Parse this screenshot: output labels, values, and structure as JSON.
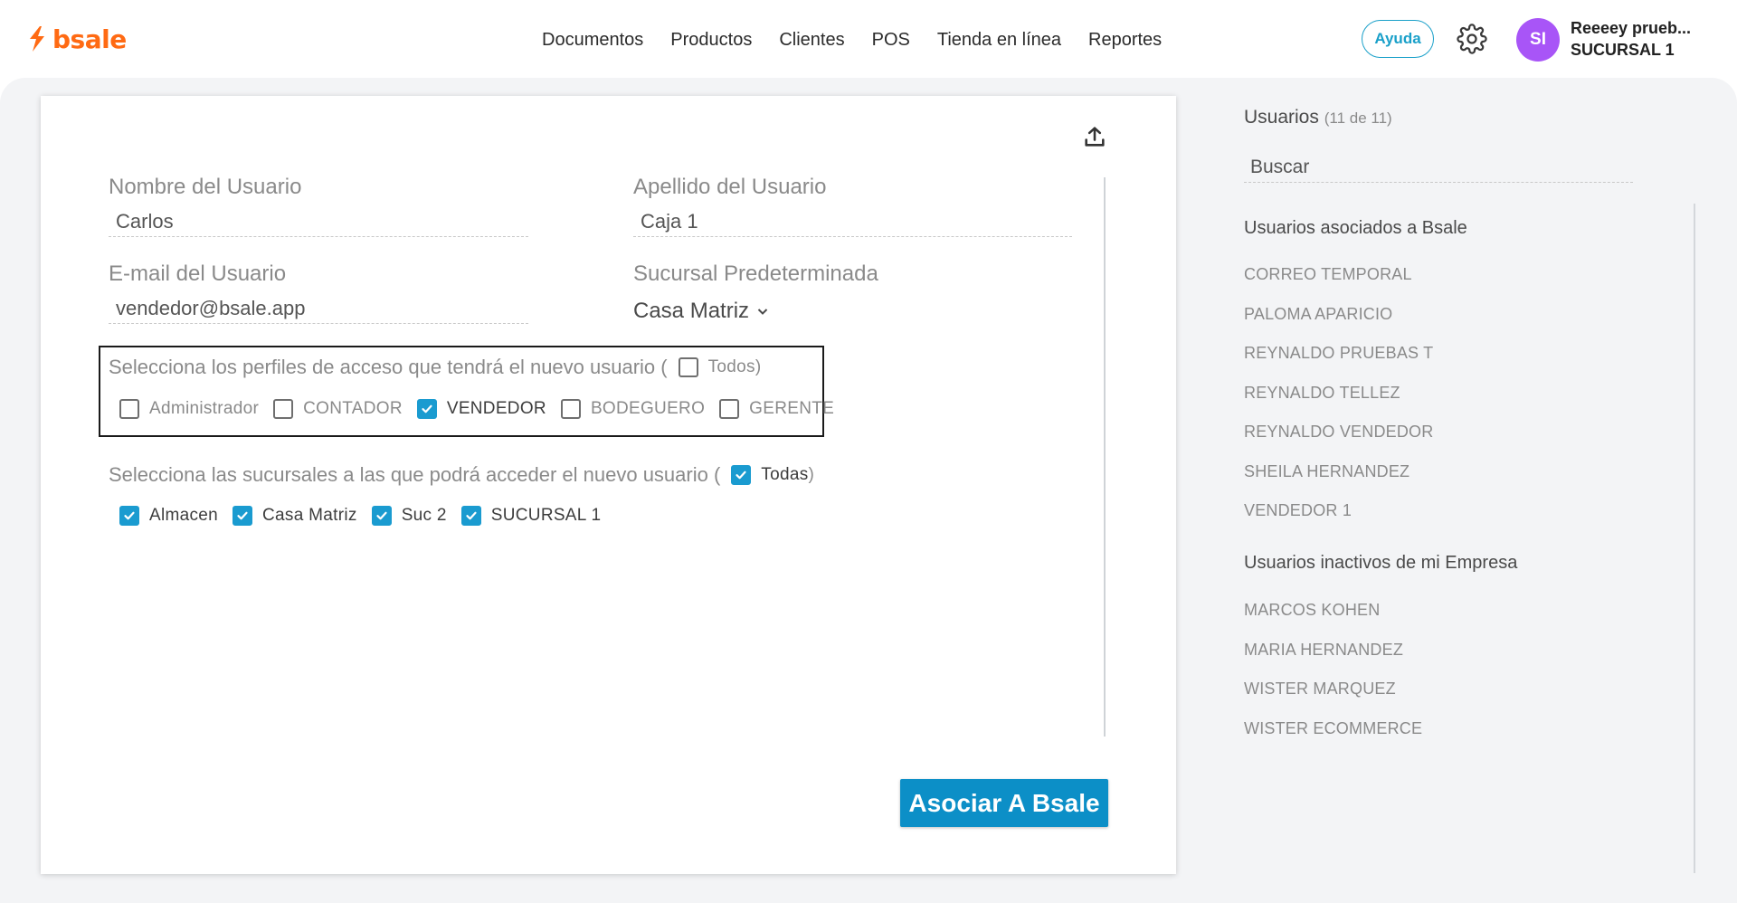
{
  "brand": {
    "name": "bsale",
    "accent": "#ff6a13"
  },
  "nav": {
    "items": [
      {
        "label": "Documentos"
      },
      {
        "label": "Productos"
      },
      {
        "label": "Clientes"
      },
      {
        "label": "POS"
      },
      {
        "label": "Tienda en línea"
      },
      {
        "label": "Reportes"
      }
    ]
  },
  "header": {
    "help_label": "Ayuda",
    "settings_icon": "gear-icon",
    "avatar_initials": "SI",
    "avatar_color": "#a855f7",
    "user_name": "Reeeey prueb...",
    "user_branch": "SUCURSAL 1"
  },
  "form": {
    "first_name_label": "Nombre del Usuario",
    "first_name_value": "Carlos",
    "last_name_label": "Apellido del Usuario",
    "last_name_value": "Caja 1",
    "email_label": "E-mail del Usuario",
    "email_value": "vendedor@bsale.app",
    "branch_label": "Sucursal Predeterminada",
    "branch_value": "Casa Matriz",
    "profiles": {
      "prompt": "Selecciona los perfiles de acceso que tendrá el nuevo usuario (",
      "all_label": "Todos",
      "all_checked": false,
      "close_paren": ")",
      "options": [
        {
          "label": "Administrador",
          "checked": false
        },
        {
          "label": "CONTADOR",
          "checked": false
        },
        {
          "label": "VENDEDOR",
          "checked": true
        },
        {
          "label": "BODEGUERO",
          "checked": false
        },
        {
          "label": "GERENTE",
          "checked": false
        }
      ]
    },
    "branches": {
      "prompt": "Selecciona las sucursales a las que podrá acceder el nuevo usuario (",
      "all_label": "Todas",
      "all_checked": true,
      "close_paren": ")",
      "options": [
        {
          "label": "Almacen",
          "checked": true
        },
        {
          "label": "Casa Matriz",
          "checked": true
        },
        {
          "label": "Suc 2",
          "checked": true
        },
        {
          "label": "SUCURSAL 1",
          "checked": true
        }
      ]
    },
    "submit_label": "Asociar A Bsale",
    "submit_color": "#0c8fc7"
  },
  "sidebar": {
    "title": "Usuarios",
    "count": "(11 de 11)",
    "search_placeholder": "Buscar",
    "associated_heading": "Usuarios asociados a Bsale",
    "associated": [
      "CORREO TEMPORAL",
      "PALOMA APARICIO",
      "REYNALDO PRUEBAS T",
      "REYNALDO TELLEZ",
      "REYNALDO VENDEDOR",
      "SHEILA HERNANDEZ",
      "VENDEDOR 1"
    ],
    "inactive_heading": "Usuarios inactivos de mi Empresa",
    "inactive": [
      "MARCOS KOHEN",
      "MARIA HERNANDEZ",
      "WISTER MARQUEZ",
      "WISTER ECOMMERCE"
    ]
  }
}
